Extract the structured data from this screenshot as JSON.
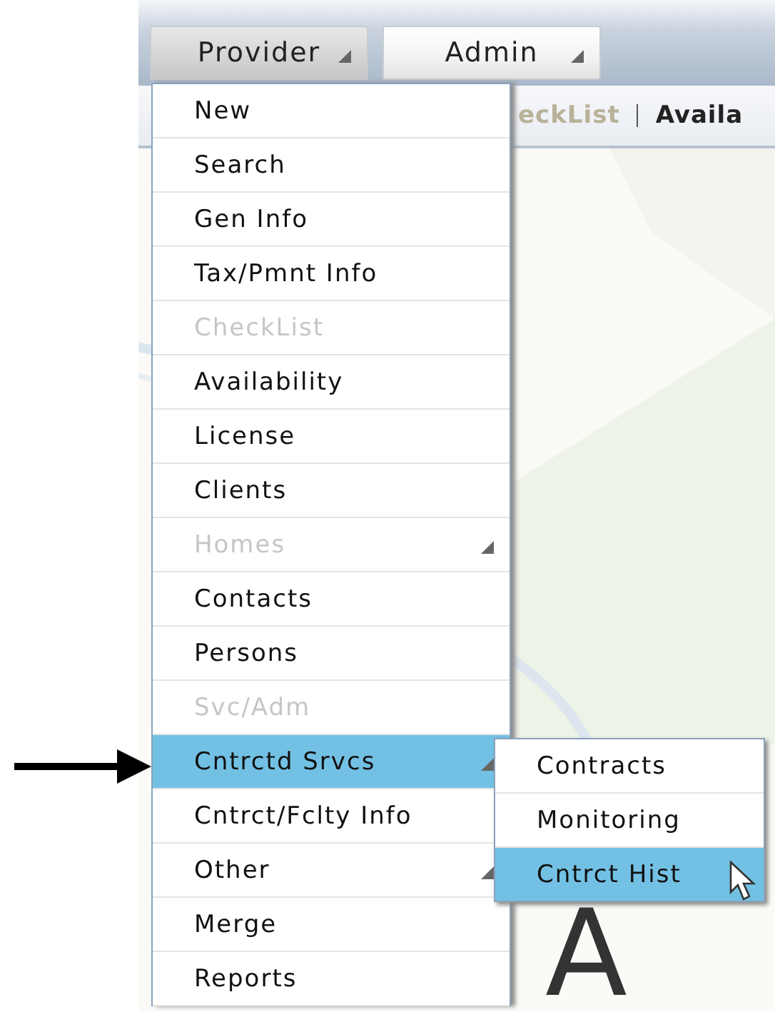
{
  "toolbar": {
    "buttons": [
      {
        "label": "Provider",
        "selected": true
      },
      {
        "label": "Admin",
        "selected": false
      }
    ]
  },
  "sub_toolbar": {
    "links": [
      {
        "label": "eckList",
        "disabled": true
      },
      {
        "label": "Availa",
        "disabled": false
      }
    ]
  },
  "content": {
    "letter": "A"
  },
  "menu": {
    "items": [
      {
        "label": "New",
        "disabled": false,
        "submenu": false,
        "selected": false
      },
      {
        "label": "Search",
        "disabled": false,
        "submenu": false,
        "selected": false
      },
      {
        "label": "Gen Info",
        "disabled": false,
        "submenu": false,
        "selected": false
      },
      {
        "label": "Tax/Pmnt Info",
        "disabled": false,
        "submenu": false,
        "selected": false
      },
      {
        "label": "CheckList",
        "disabled": true,
        "submenu": false,
        "selected": false
      },
      {
        "label": "Availability",
        "disabled": false,
        "submenu": false,
        "selected": false
      },
      {
        "label": "License",
        "disabled": false,
        "submenu": false,
        "selected": false
      },
      {
        "label": "Clients",
        "disabled": false,
        "submenu": false,
        "selected": false
      },
      {
        "label": "Homes",
        "disabled": true,
        "submenu": true,
        "selected": false
      },
      {
        "label": "Contacts",
        "disabled": false,
        "submenu": false,
        "selected": false
      },
      {
        "label": "Persons",
        "disabled": false,
        "submenu": false,
        "selected": false
      },
      {
        "label": "Svc/Adm",
        "disabled": true,
        "submenu": false,
        "selected": false
      },
      {
        "label": "Cntrctd Srvcs",
        "disabled": false,
        "submenu": true,
        "selected": true
      },
      {
        "label": "Cntrct/Fclty Info",
        "disabled": false,
        "submenu": false,
        "selected": false
      },
      {
        "label": "Other",
        "disabled": false,
        "submenu": true,
        "selected": false
      },
      {
        "label": "Merge",
        "disabled": false,
        "submenu": false,
        "selected": false
      },
      {
        "label": "Reports",
        "disabled": false,
        "submenu": false,
        "selected": false
      }
    ]
  },
  "submenu": {
    "items": [
      {
        "label": "Contracts",
        "selected": false
      },
      {
        "label": "Monitoring",
        "selected": false
      },
      {
        "label": "Cntrct Hist",
        "selected": true
      }
    ]
  }
}
